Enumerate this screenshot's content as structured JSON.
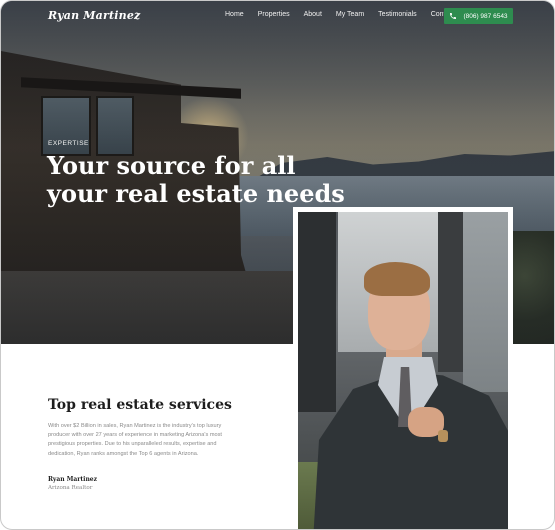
{
  "nav": {
    "logo": "Ryan Martinez",
    "items": [
      "Home",
      "Properties",
      "About",
      "My Team",
      "Testimonials",
      "Contact"
    ],
    "phone": "(806) 987 6543",
    "phone_button_color": "#2e8c4f",
    "phone_icon": "phone-icon"
  },
  "hero": {
    "kicker": "EXPERTISE",
    "headline": "Your source for all your real estate needs"
  },
  "services": {
    "title": "Top real estate services",
    "text": "With over $2 Billion in sales, Ryan Martinez is the industry's top luxury producer with over 27 years of experience in marketing Arizona's most prestigious properties. Due to his unparalleled results, expertise and dedication, Ryan ranks amongst the Top 6 agents in Arizona.",
    "signature_name": "Ryan Martinez",
    "signature_role": "Arizona Realtor"
  }
}
